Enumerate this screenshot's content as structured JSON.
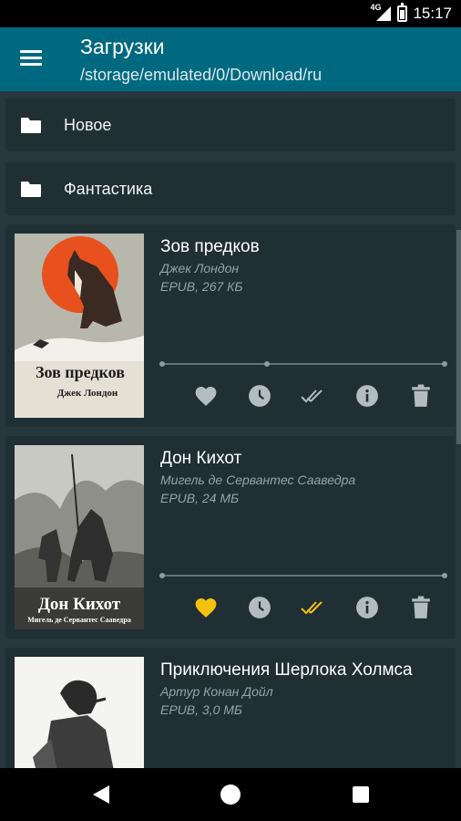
{
  "status_bar": {
    "network": "4G",
    "time": "15:17"
  },
  "header": {
    "title": "Загрузки",
    "path": "/storage/emulated/0/Download/ru"
  },
  "folders": [
    {
      "label": "Новое"
    },
    {
      "label": "Фантастика"
    }
  ],
  "books": [
    {
      "title": "Зов предков",
      "author": "Джек Лондон",
      "meta": "EPUB, 267 КБ",
      "cover_title": "Зов предков",
      "cover_author": "Джек Лондон",
      "favorite": false,
      "read": false
    },
    {
      "title": "Дон Кихот",
      "author": "Мигель де Сервантес Сааведра",
      "meta": "EPUB, 24 МБ",
      "cover_title": "Дон Кихот",
      "cover_author": "Мигель де Сервантес Сааведра",
      "favorite": true,
      "read": true
    },
    {
      "title": "Приключения Шерлока Холмса",
      "author": "Артур Конан Дойл",
      "meta": "EPUB, 3,0 МБ",
      "favorite": false,
      "read": false
    }
  ],
  "colors": {
    "app_bar": "#006980",
    "card": "#1f2f34",
    "background": "#27373d",
    "accent_active": "#f4c20d",
    "icon_inactive": "#b3bcc0"
  },
  "icons": {
    "menu": "menu-icon",
    "folder": "folder-icon",
    "favorite": "heart-icon",
    "later": "clock-icon",
    "read": "double-check-icon",
    "info": "info-icon",
    "delete": "trash-icon"
  }
}
